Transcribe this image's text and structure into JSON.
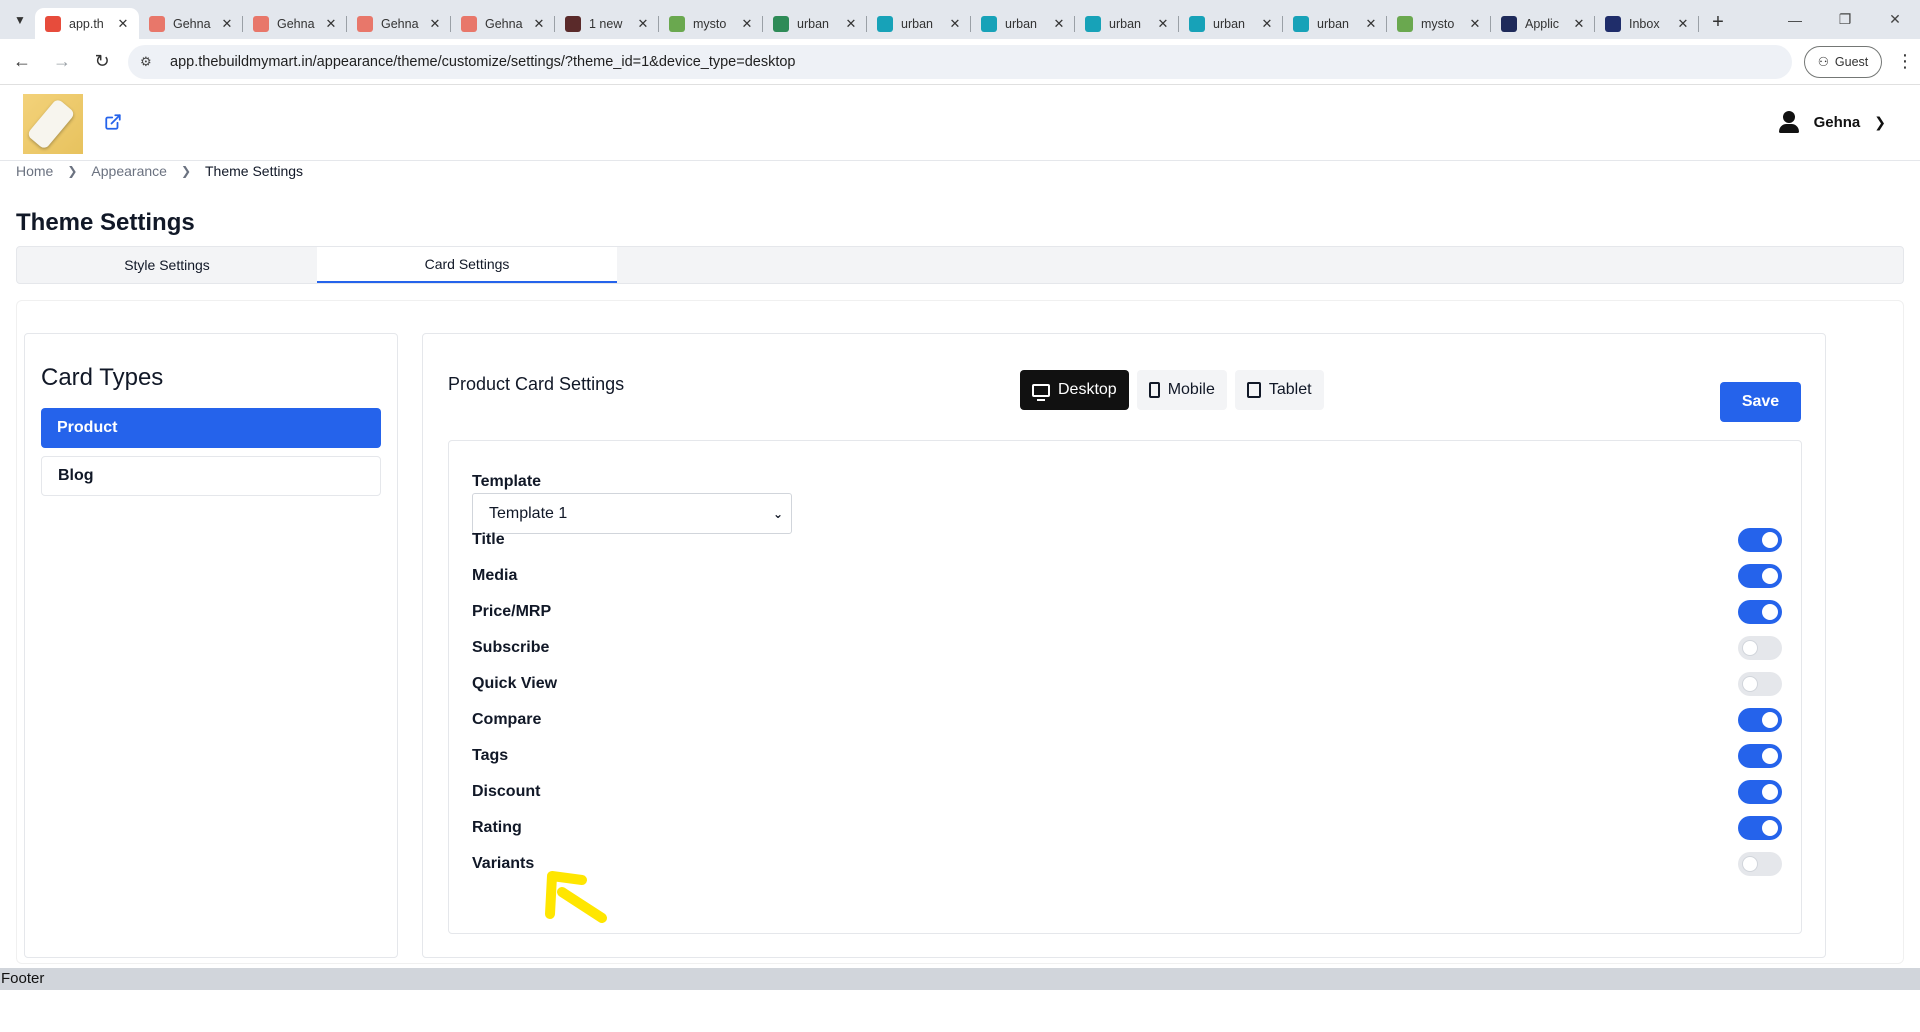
{
  "browser": {
    "tabs": [
      {
        "title": "app.th",
        "active": true,
        "fav_color": "#e74c3c"
      },
      {
        "title": "Gehna",
        "active": false,
        "fav_color": "#e8776a"
      },
      {
        "title": "Gehna",
        "active": false,
        "fav_color": "#e8776a"
      },
      {
        "title": "Gehna",
        "active": false,
        "fav_color": "#e8776a"
      },
      {
        "title": "Gehna",
        "active": false,
        "fav_color": "#e8776a"
      },
      {
        "title": "1 new",
        "active": false,
        "fav_color": "#5a2a2a"
      },
      {
        "title": "mysto",
        "active": false,
        "fav_color": "#6aa84f"
      },
      {
        "title": "urban",
        "active": false,
        "fav_color": "#2e8b57"
      },
      {
        "title": "urban",
        "active": false,
        "fav_color": "#17a2b8"
      },
      {
        "title": "urban",
        "active": false,
        "fav_color": "#17a2b8"
      },
      {
        "title": "urban",
        "active": false,
        "fav_color": "#17a2b8"
      },
      {
        "title": "urban",
        "active": false,
        "fav_color": "#17a2b8"
      },
      {
        "title": "urban",
        "active": false,
        "fav_color": "#17a2b8"
      },
      {
        "title": "mysto",
        "active": false,
        "fav_color": "#6aa84f"
      },
      {
        "title": "Applic",
        "active": false,
        "fav_color": "#1e2a5a"
      },
      {
        "title": "Inbox",
        "active": false,
        "fav_color": "#1f2d6a"
      }
    ],
    "url": "app.thebuildmymart.in/appearance/theme/customize/settings/?theme_id=1&device_type=desktop",
    "profile_label": "Guest"
  },
  "header": {
    "user_name": "Gehna"
  },
  "breadcrumb": {
    "items": [
      "Home",
      "Appearance",
      "Theme Settings"
    ]
  },
  "page": {
    "title": "Theme Settings",
    "tabs": [
      {
        "label": "Style Settings",
        "active": false
      },
      {
        "label": "Card Settings",
        "active": true
      }
    ]
  },
  "card_types": {
    "heading": "Card Types",
    "items": [
      {
        "label": "Product",
        "active": true
      },
      {
        "label": "Blog",
        "active": false
      }
    ]
  },
  "product_settings": {
    "title": "Product Card Settings",
    "devices": [
      {
        "label": "Desktop",
        "icon": "monitor-icon",
        "active": true
      },
      {
        "label": "Mobile",
        "icon": "phone-icon",
        "active": false
      },
      {
        "label": "Tablet",
        "icon": "tablet-icon",
        "active": false
      }
    ],
    "save_label": "Save",
    "template_label": "Template",
    "template_value": "Template 1",
    "options": [
      {
        "label": "Title",
        "enabled": true
      },
      {
        "label": "Media",
        "enabled": true
      },
      {
        "label": "Price/MRP",
        "enabled": true
      },
      {
        "label": "Subscribe",
        "enabled": false
      },
      {
        "label": "Quick View",
        "enabled": false
      },
      {
        "label": "Compare",
        "enabled": true
      },
      {
        "label": "Tags",
        "enabled": true
      },
      {
        "label": "Discount",
        "enabled": true
      },
      {
        "label": "Rating",
        "enabled": true
      },
      {
        "label": "Variants",
        "enabled": false
      }
    ]
  },
  "footer": {
    "text": "Footer"
  },
  "colors": {
    "primary": "#2563eb",
    "annotation_arrow": "#ffe600"
  }
}
